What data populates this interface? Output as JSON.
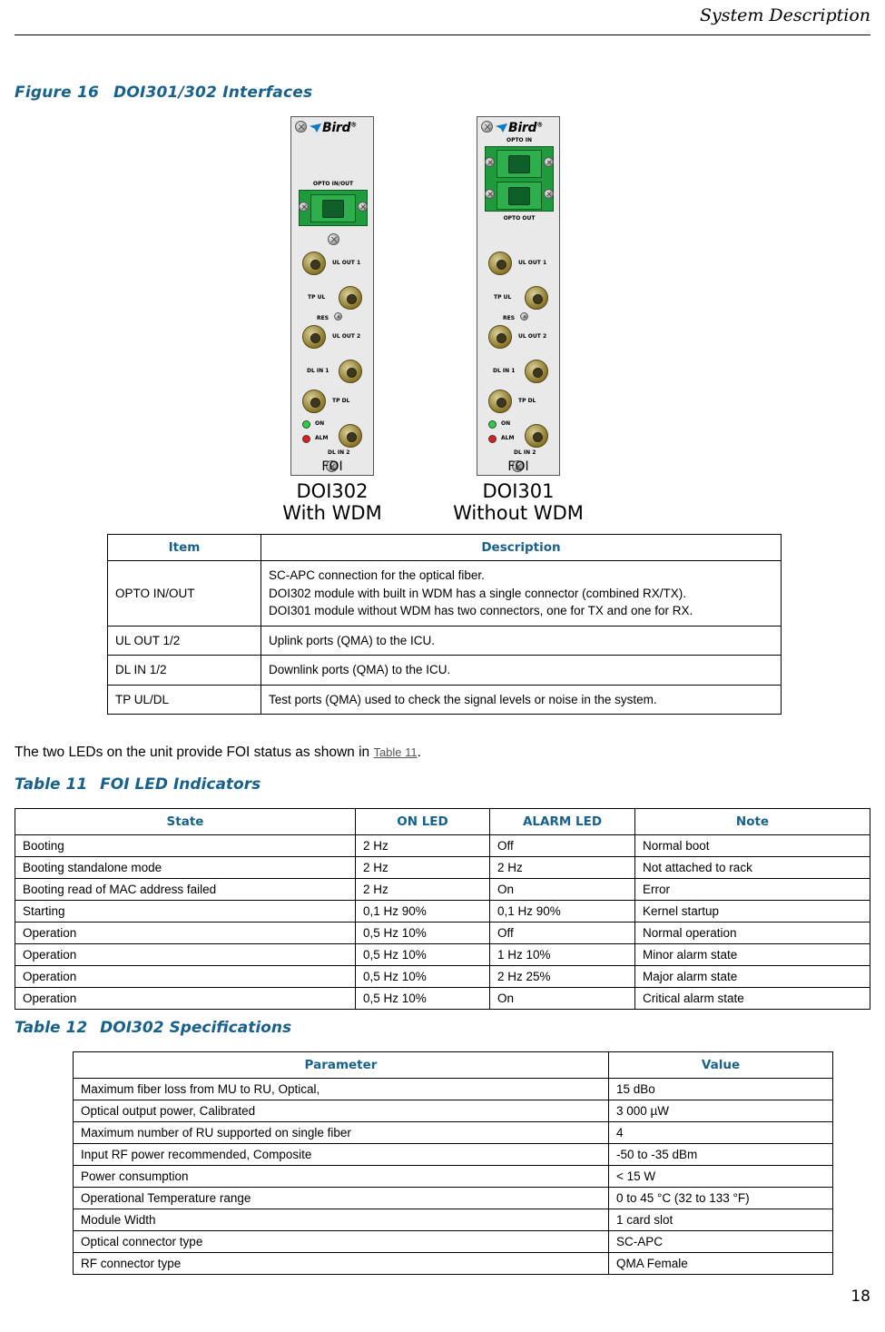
{
  "header": {
    "title": "System Description"
  },
  "page_number": "18",
  "figure": {
    "num": "Figure 16",
    "title": "DOI301/302 Interfaces",
    "modules": [
      {
        "brand": "Bird",
        "opto_label": "OPTO IN/OUT",
        "ports": [
          "UL OUT 1",
          "TP UL",
          "RES",
          "UL OUT 2",
          "DL IN 1",
          "TP DL",
          "DL IN 2"
        ],
        "leds": [
          "ON",
          "ALM"
        ],
        "foi": "FOI",
        "title_line1": "DOI302",
        "title_line2": "With WDM"
      },
      {
        "brand": "Bird",
        "opto_in_label": "OPTO IN",
        "opto_out_label": "OPTO OUT",
        "ports": [
          "UL OUT 1",
          "TP UL",
          "RES",
          "UL OUT 2",
          "DL IN 1",
          "TP DL",
          "DL IN 2"
        ],
        "leds": [
          "ON",
          "ALM"
        ],
        "foi": "FOI",
        "title_line1": "DOI301",
        "title_line2": "Without WDM"
      }
    ]
  },
  "interfaces_table": {
    "headers": [
      "Item",
      "Description"
    ],
    "rows": [
      {
        "item": "OPTO IN/OUT",
        "desc_lines": [
          "SC-APC connection for the optical fiber.",
          "DOI302 module with built in WDM has a single connector (combined RX/TX).",
          "DOI301 module without WDM has two connectors, one for TX and one for RX."
        ]
      },
      {
        "item": "UL OUT 1/2",
        "desc_lines": [
          "Uplink ports (QMA) to the ICU."
        ]
      },
      {
        "item": "DL IN 1/2",
        "desc_lines": [
          "Downlink ports (QMA) to the ICU."
        ]
      },
      {
        "item": "TP UL/DL",
        "desc_lines": [
          "Test ports (QMA) used to check the signal levels or noise in the system."
        ]
      }
    ]
  },
  "paragraph": {
    "before": "The two LEDs on the unit provide FOI status as shown in ",
    "xref": "Table 11",
    "after": "."
  },
  "led_table": {
    "caption_num": "Table 11",
    "caption_title": "FOI LED Indicators",
    "headers": [
      "State",
      "ON LED",
      "ALARM LED",
      "Note"
    ],
    "rows": [
      [
        "Booting",
        "2 Hz",
        "Off",
        "Normal boot"
      ],
      [
        "Booting standalone mode",
        "2 Hz",
        "2 Hz",
        "Not attached to rack"
      ],
      [
        "Booting read of MAC address failed",
        "2 Hz",
        "On",
        "Error"
      ],
      [
        "Starting",
        "0,1 Hz 90%",
        "0,1 Hz 90%",
        "Kernel startup"
      ],
      [
        "Operation",
        "0,5 Hz 10%",
        "Off",
        "Normal operation"
      ],
      [
        "Operation",
        "0,5 Hz 10%",
        "1 Hz 10%",
        "Minor alarm state"
      ],
      [
        "Operation",
        "0,5 Hz 10%",
        "2 Hz 25%",
        "Major alarm state"
      ],
      [
        "Operation",
        "0,5 Hz 10%",
        "On",
        "Critical alarm state"
      ]
    ]
  },
  "spec_table": {
    "caption_num": "Table 12",
    "caption_title": "DOI302 Specifications",
    "headers": [
      "Parameter",
      "Value"
    ],
    "rows": [
      [
        "Maximum fiber loss from MU to RU, Optical,",
        " 15 dBo"
      ],
      [
        "Optical output power, Calibrated",
        "3 000 µW"
      ],
      [
        "Maximum number of RU supported on single fiber",
        "4"
      ],
      [
        "Input RF power recommended, Composite",
        "-50 to -35 dBm"
      ],
      [
        "Power consumption",
        "< 15 W"
      ],
      [
        "Operational Temperature range",
        "0 to 45 °C (32 to 133 °F)"
      ],
      [
        "Module Width",
        "1 card slot"
      ],
      [
        "Optical connector type",
        "SC-APC"
      ],
      [
        "RF connector type",
        "QMA Female"
      ]
    ]
  },
  "colors": {
    "accent": "#18618c",
    "green_panel": "#1f9a3c",
    "led_on": "#27d13f",
    "led_alarm": "#e01b1b"
  }
}
